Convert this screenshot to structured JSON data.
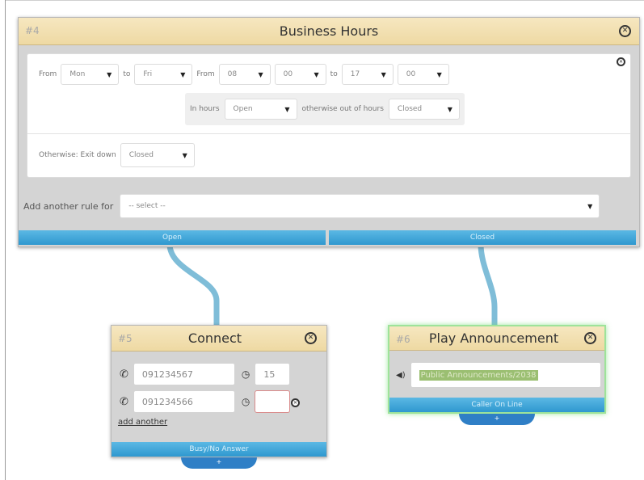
{
  "business_hours": {
    "id": "#4",
    "title": "Business Hours",
    "rule": {
      "from_label": "From",
      "from_day": "Mon",
      "to_label": "to",
      "to_day": "Fri",
      "from_time_label": "From",
      "from_hour": "08",
      "from_minute": "00",
      "to_time_label": "to",
      "to_hour": "17",
      "to_minute": "00",
      "in_hours_label": "In hours",
      "in_hours_value": "Open",
      "otherwise_label": "otherwise out of hours",
      "otherwise_value": "Closed"
    },
    "fallback": {
      "label": "Otherwise: Exit down",
      "value": "Closed"
    },
    "add_rule": {
      "label": "Add another rule for",
      "placeholder": "-- select --"
    },
    "outputs": [
      "Open",
      "Closed"
    ]
  },
  "connect": {
    "id": "#5",
    "title": "Connect",
    "rows": [
      {
        "number": "091234567",
        "timeout": "15"
      },
      {
        "number": "091234566",
        "timeout": ""
      }
    ],
    "add_another": "add another",
    "output": "Busy/No Answer",
    "add_tab": "+"
  },
  "play_announcement": {
    "id": "#6",
    "title": "Play Announcement",
    "file": "Public Announcements/2038",
    "output": "Caller On Line",
    "add_tab": "+"
  },
  "colors": {
    "header": "#eed9a3",
    "output_bar": "#2f98cf",
    "connector": "#7fbdd8",
    "selected_outline": "#9ee39a",
    "error_border": "#d98a8a"
  }
}
